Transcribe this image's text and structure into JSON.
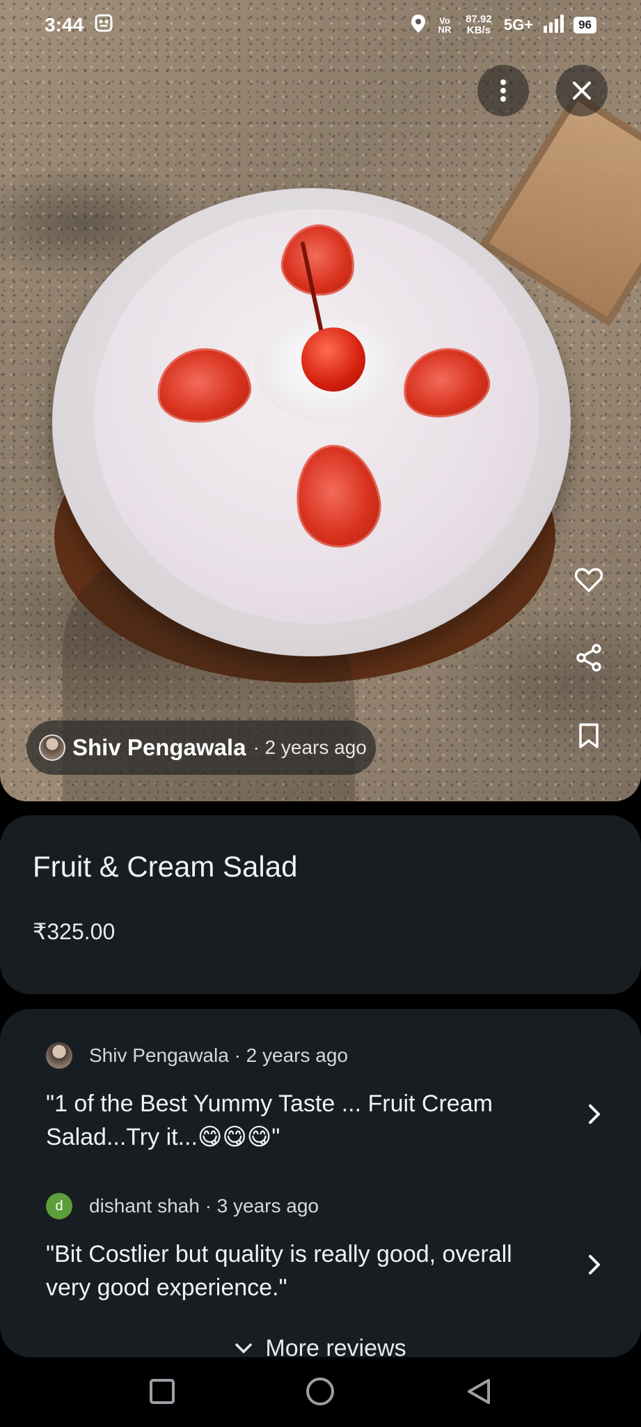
{
  "status_bar": {
    "time": "3:44",
    "net_tag": "Vo NR",
    "speed": "87.92 KB/s",
    "network": "5G+",
    "battery": "96"
  },
  "photo": {
    "author_name": "Shiv Pengawala",
    "author_time": "· 2 years ago"
  },
  "dish": {
    "title": "Fruit & Cream Salad",
    "price": "₹325.00"
  },
  "reviews": [
    {
      "author": "Shiv Pengawala · 2 years ago",
      "text": "\"1 of the Best Yummy Taste ... Fruit Cream Salad...Try it...😋😋😋\""
    },
    {
      "avatar_letter": "d",
      "author": "dishant shah · 3 years ago",
      "text": "\"Bit Costlier but quality is really good, overall very good experience.\""
    }
  ],
  "more_reviews_label": "More reviews",
  "colors": {
    "card_bg": "#171d21",
    "page_bg": "#000000",
    "avatar_green": "#5c9e3a"
  }
}
